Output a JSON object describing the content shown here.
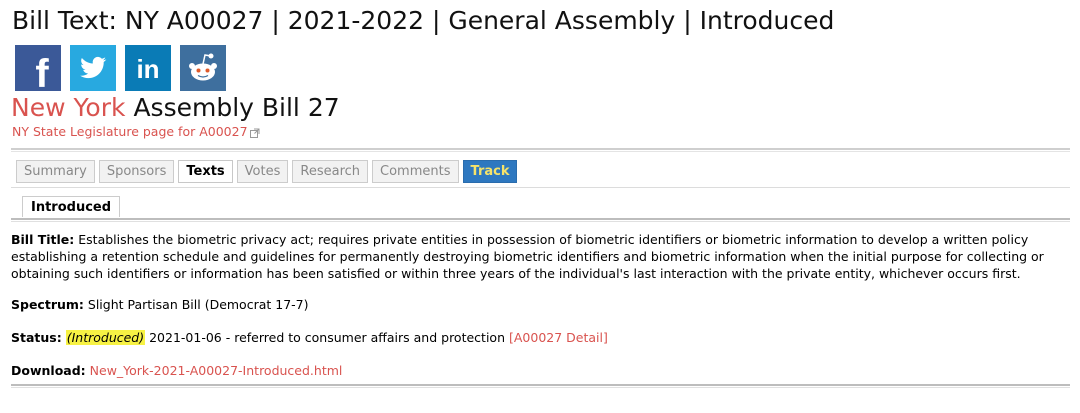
{
  "page_title": "Bill Text: NY A00027 | 2021-2022 | General Assembly | Introduced",
  "social": {
    "facebook": "f",
    "linkedin": "in"
  },
  "bill_heading": {
    "state": "New York",
    "bill": "Assembly Bill 27"
  },
  "legislature_link": "NY State Legislature page for A00027",
  "tabs": [
    {
      "label": "Summary"
    },
    {
      "label": "Sponsors"
    },
    {
      "label": "Texts"
    },
    {
      "label": "Votes"
    },
    {
      "label": "Research"
    },
    {
      "label": "Comments"
    },
    {
      "label": "Track"
    }
  ],
  "subtab": "Introduced",
  "bill_title": {
    "label": "Bill Title:",
    "text": "Establishes the biometric privacy act; requires private entities in possession of biometric identifiers or biometric information to develop a written policy establishing a retention schedule and guidelines for permanently destroying biometric identifiers and biometric information when the initial purpose for collecting or obtaining such identifiers or information has been satisfied or within three years of the individual's last interaction with the private entity, whichever occurs first."
  },
  "spectrum": {
    "label": "Spectrum:",
    "text": "Slight Partisan Bill (Democrat 17-7)"
  },
  "status": {
    "label": "Status:",
    "badge": "(Introduced)",
    "text": "2021-01-06 - referred to consumer affairs and protection",
    "detail_link": "[A00027 Detail]"
  },
  "download": {
    "label": "Download:",
    "link": "New_York-2021-A00027-Introduced.html"
  },
  "colors": {
    "link": "#d9534f",
    "facebook": "#3b5998",
    "twitter": "#28a9e0",
    "linkedin": "#0a7bb6",
    "reddit": "#3e6f9e",
    "track": "#2e78c0",
    "highlight": "#f7f244"
  }
}
